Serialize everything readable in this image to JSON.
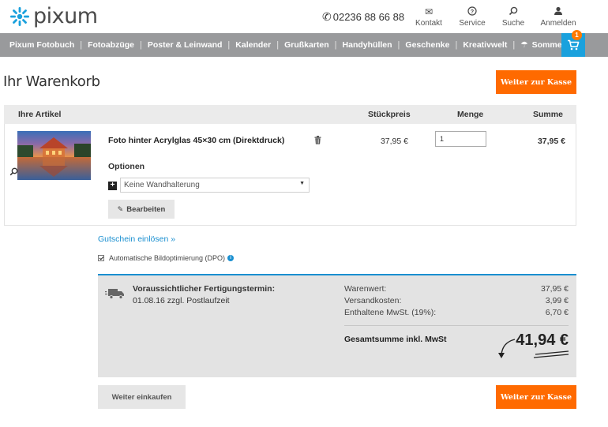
{
  "header": {
    "logo_text": "pixum",
    "phone": "02236 88 66 88",
    "links": [
      {
        "label": "Kontakt",
        "icon": "contact-icon"
      },
      {
        "label": "Service",
        "icon": "help-icon"
      },
      {
        "label": "Suche",
        "icon": "search-icon"
      },
      {
        "label": "Anmelden",
        "icon": "user-icon"
      }
    ]
  },
  "nav": {
    "items": [
      "Pixum Fotobuch",
      "Fotoabzüge",
      "Poster & Leinwand",
      "Kalender",
      "Grußkarten",
      "Handyhüllen",
      "Geschenke",
      "Kreativwelt",
      "Sommer"
    ],
    "cart_count": "1"
  },
  "page": {
    "title": "Ihr Warenkorb",
    "checkout_label": "Weiter zur Kasse",
    "continue_label": "Weiter einkaufen"
  },
  "table": {
    "headers": {
      "articles": "Ihre Artikel",
      "unit_price": "Stückpreis",
      "quantity": "Menge",
      "sum": "Summe"
    },
    "item": {
      "name": "Foto hinter Acrylglas 45×30 cm (Direktdruck)",
      "unit_price": "37,95 €",
      "quantity": "1",
      "sum": "37,95 €",
      "options_label": "Optionen",
      "option_selected": "Keine Wandhalterung",
      "edit_label": "Bearbeiten"
    }
  },
  "voucher_link": "Gutschein einlösen »",
  "dpo_label": "Automatische Bildoptimierung (DPO)",
  "summary": {
    "production_title": "Voraussichtlicher Fertigungstermin:",
    "production_date": "01.08.16 zzgl. Postlaufzeit",
    "rows": [
      {
        "label": "Warenwert:",
        "value": "37,95 €"
      },
      {
        "label": "Versandkosten:",
        "value": "3,99 €"
      },
      {
        "label": "Enthaltene MwSt. (19%):",
        "value": "6,70 €"
      }
    ],
    "total_label": "Gesamtsumme inkl. MwSt",
    "total_value": "41,94 €"
  },
  "colors": {
    "accent_orange": "#ff6a00",
    "accent_blue": "#1aa1dd",
    "nav_grey": "#999a9c"
  }
}
